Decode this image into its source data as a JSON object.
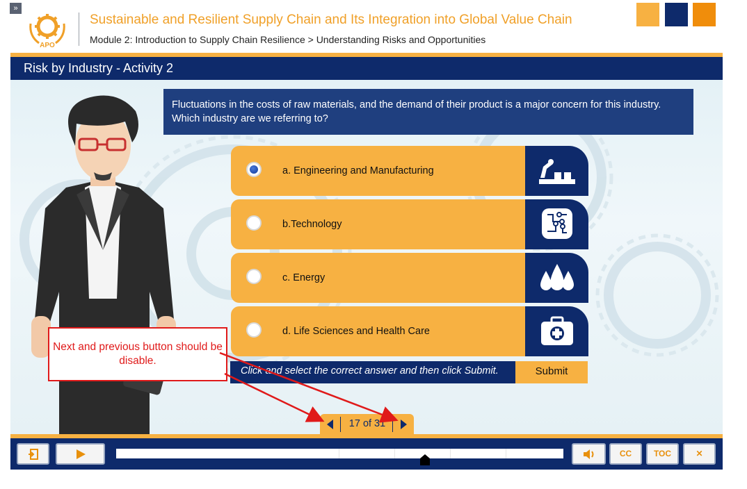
{
  "header": {
    "course_title": "Sustainable and Resilient Supply Chain and Its Integration into Global Value Chain",
    "breadcrumb": "Module 2: Introduction to Supply Chain Resilience > Understanding Risks and Opportunities",
    "logo_text": "APO",
    "expand_glyph": "»"
  },
  "slide": {
    "title": "Risk by Industry - Activity 2",
    "question": "Fluctuations in the costs of raw materials, and the demand of their product is a major concern for this industry. Which industry are we referring to?",
    "options": [
      {
        "label": "a. Engineering and Manufacturing",
        "selected": true,
        "icon": "factory-robot-icon"
      },
      {
        "label": "b.Technology",
        "selected": false,
        "icon": "circuit-icon"
      },
      {
        "label": "c. Energy",
        "selected": false,
        "icon": "droplets-icon"
      },
      {
        "label": "d. Life Sciences and Health Care",
        "selected": false,
        "icon": "medical-kit-icon"
      }
    ],
    "instruction": "Click and select the correct answer and then click Submit.",
    "submit_label": "Submit",
    "page_counter": "17 of 31",
    "current_page": 17,
    "total_pages": 31
  },
  "annotation": {
    "text": "Next and previous button should be disable."
  },
  "controls": {
    "cc_label": "CC",
    "toc_label": "TOC",
    "close_label": "✕",
    "progress": 0.69
  },
  "colors": {
    "navy": "#0e2a6b",
    "orange": "#f7b142",
    "dark_orange": "#f08d0b",
    "title_orange": "#f0a028",
    "annotation_red": "#e01a1a"
  }
}
